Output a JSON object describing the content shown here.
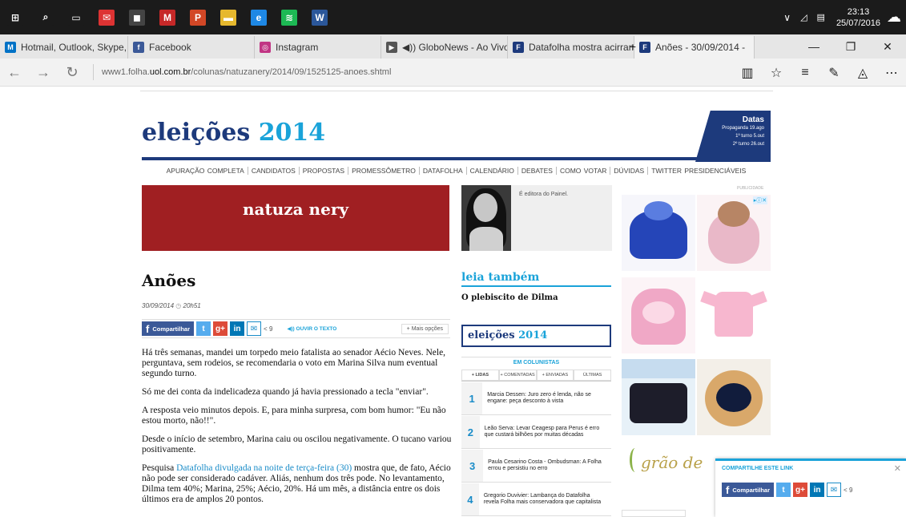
{
  "taskbar": {
    "apps": [
      {
        "name": "windows-icon",
        "glyph": "⊞",
        "color": "#1b1b1b"
      },
      {
        "name": "search-icon",
        "glyph": "⌕",
        "color": "#1b1b1b"
      },
      {
        "name": "task-view-icon",
        "glyph": "▭",
        "color": "#1b1b1b"
      },
      {
        "name": "mail-icon",
        "glyph": "✉",
        "color": "#d33"
      },
      {
        "name": "store-icon",
        "glyph": "◼",
        "color": "#444"
      },
      {
        "name": "mcafee-icon",
        "glyph": "M",
        "color": "#c62828"
      },
      {
        "name": "powerpoint-icon",
        "glyph": "P",
        "color": "#d24726"
      },
      {
        "name": "explorer-icon",
        "glyph": "▬",
        "color": "#e6b82e"
      },
      {
        "name": "edge-icon",
        "glyph": "e",
        "color": "#1e88e5"
      },
      {
        "name": "spotify-icon",
        "glyph": "≋",
        "color": "#1db954"
      },
      {
        "name": "word-icon",
        "glyph": "W",
        "color": "#2b579a"
      }
    ],
    "time": "23:13",
    "date": "25/07/2016"
  },
  "tabs": [
    {
      "label": "Hotmail, Outlook, Skype, F",
      "fav": "M",
      "color": "#0072c6",
      "w": 160
    },
    {
      "label": "Facebook",
      "fav": "f",
      "color": "#3b5998",
      "w": 158
    },
    {
      "label": "Instagram",
      "fav": "◎",
      "color": "#c13584",
      "w": 158
    },
    {
      "label": "◀)) GloboNews - Ao Vivo",
      "fav": "▶",
      "color": "#555",
      "w": 158
    },
    {
      "label": "Datafolha mostra acirrame",
      "fav": "F",
      "color": "#1d3a7c",
      "w": 158
    },
    {
      "label": "Anões - 30/09/2014 -",
      "fav": "F",
      "color": "#1d3a7c",
      "w": 150,
      "active": true
    }
  ],
  "browser": {
    "url_prefix": "www1.folha.",
    "url_domain": "uol.com.br",
    "url_path": "/colunas/natuzanery/2014/09/1525125-anoes.shtml"
  },
  "site": {
    "logo": "eleições",
    "logo_year": "2014",
    "datas_title": "Datas",
    "datas_rows": [
      "Propaganda 19.ago",
      "1º turno 5.out",
      "2º turno 26.out"
    ],
    "menu": [
      "APURAÇÃO COMPLETA",
      "CANDIDATOS",
      "PROPOSTAS",
      "PROMESSÔMETRO",
      "DATAFOLHA",
      "CALENDÁRIO",
      "DEBATES",
      "COMO VOTAR",
      "DÚVIDAS",
      "TWITTER PRESIDENCIÁVEIS"
    ],
    "columnist": "natuza nery",
    "bio": "É editora do Painel.",
    "publicidade": "PUBLICIDADE"
  },
  "article": {
    "title": "Anões",
    "date": "30/09/2014",
    "time": "20h51",
    "share_label": "Compartilhar",
    "share_count": "9",
    "ouvir": "OUVIR O TEXTO",
    "mais": "Mais opções",
    "p1": "Há três semanas, mandei um torpedo meio fatalista ao senador Aécio Neves. Nele, perguntava, sem rodeios, se recomendaria o voto em Marina Silva num eventual segundo turno.",
    "p2": "Só me dei conta da indelicadeza quando já havia pressionado a tecla \"enviar\".",
    "p3": "A resposta veio minutos depois. E, para minha surpresa, com bom humor: \"Eu não estou morto, não!!\".",
    "p4": "Desde o início de setembro, Marina caiu ou oscilou negativamente. O tucano variou positivamente.",
    "p5_pre": "Pesquisa ",
    "p5_link": "Datafolha divulgada na noite de terça-feira (30)",
    "p5_post": " mostra que, de fato, Aécio não pode ser considerado cadáver. Aliás, nenhum dos três pode. No levantamento, Dilma tem 40%; Marina, 25%; Aécio, 20%. Há um mês, a distância entre os dois últimos era de amplos 20 pontos."
  },
  "sidebar": {
    "leia": "leia também",
    "related": "O plebiscito de Dilma",
    "eleicoes": "eleições",
    "eleicoes_year": "2014",
    "em_colunistas": "EM COLUNISTAS",
    "tabs": [
      "+ LIDAS",
      "+ COMENTADAS",
      "+ ENVIADAS",
      "ÚLTIMAS"
    ],
    "items": [
      {
        "n": "1",
        "text": "Marcia Dessen: Juro zero é lenda, não se engane: peça desconto à vista"
      },
      {
        "n": "2",
        "text": "Leão Serva: Levar Ceagesp para Perus é erro que custará bilhões por muitas décadas"
      },
      {
        "n": "3",
        "text": "Paula Cesarino Costa - Ombudsman: A Folha errou e persistiu no erro"
      },
      {
        "n": "4",
        "text": "Gregorio Duvivier: Lambança do Datafolha revela Folha mais conservadora que capitalista"
      }
    ]
  },
  "ad": {
    "brand": "grão de"
  },
  "popup": {
    "title": "COMPARTILHE ESTE LINK",
    "share_label": "Compartilhar",
    "share_count": "9"
  }
}
